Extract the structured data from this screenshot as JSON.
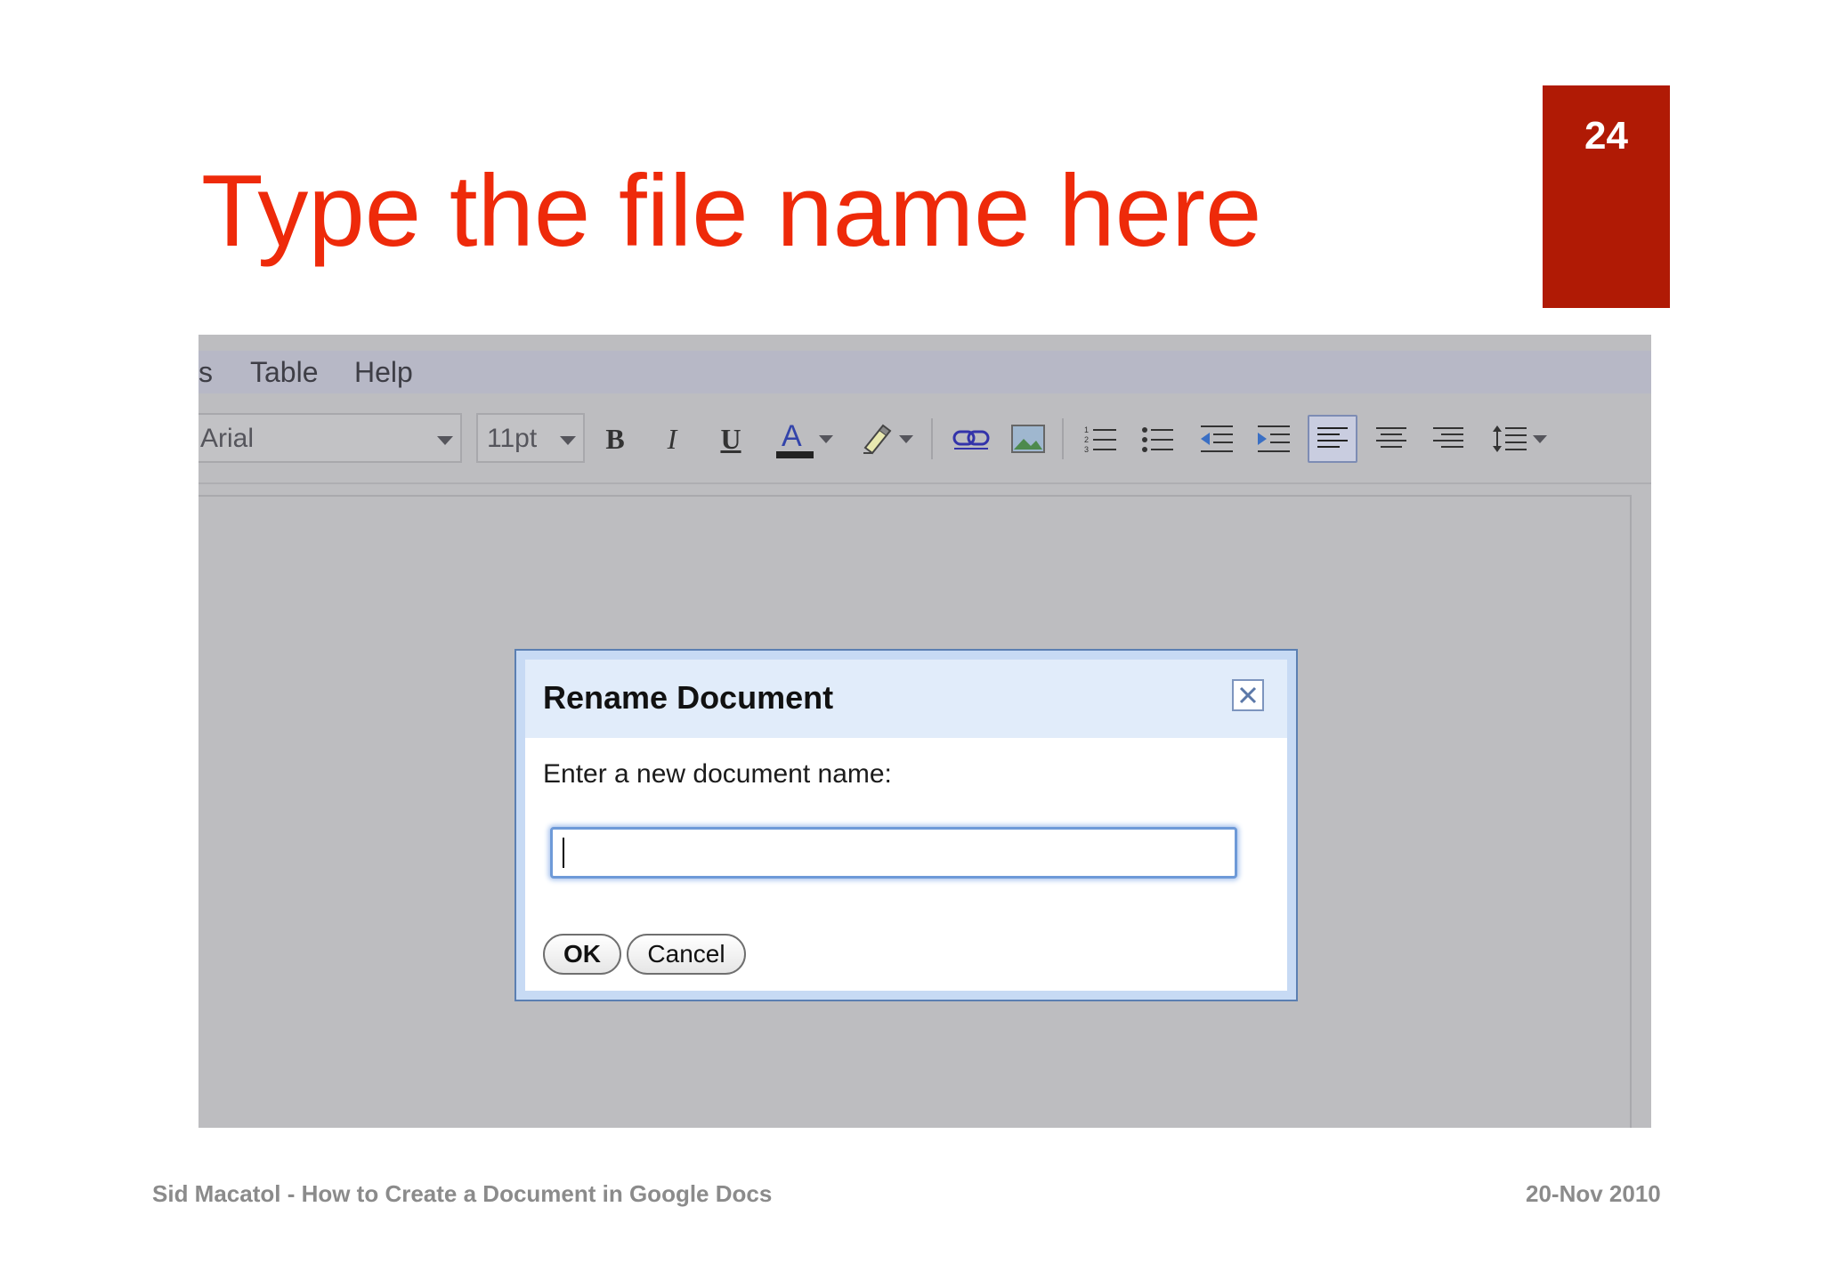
{
  "slide": {
    "number": "24",
    "title": "Type the file name here",
    "footer_left": "Sid Macatol - How to Create a Document in Google Docs",
    "footer_right": "20-Nov 2010",
    "accent_color": "#b01a05",
    "title_color": "#ee2a0a"
  },
  "app": {
    "menu": [
      {
        "label": "s"
      },
      {
        "label": "Table"
      },
      {
        "label": "Help"
      }
    ],
    "toolbar": {
      "font_family": "Arial",
      "font_size": "11pt",
      "buttons": [
        {
          "icon": "bold-icon"
        },
        {
          "icon": "italic-icon"
        },
        {
          "icon": "underline-icon"
        },
        {
          "icon": "text-color-icon"
        },
        {
          "icon": "highlight-color-icon"
        },
        {
          "icon": "link-icon"
        },
        {
          "icon": "insert-image-icon"
        },
        {
          "icon": "numbered-list-icon"
        },
        {
          "icon": "bulleted-list-icon"
        },
        {
          "icon": "decrease-indent-icon"
        },
        {
          "icon": "increase-indent-icon"
        },
        {
          "icon": "align-left-icon",
          "active": true
        },
        {
          "icon": "align-center-icon"
        },
        {
          "icon": "align-right-icon"
        },
        {
          "icon": "line-spacing-icon"
        }
      ],
      "bold_label": "B",
      "italic_label": "I",
      "underline_label": "U",
      "text_color_label": "A"
    }
  },
  "dialog": {
    "title": "Rename Document",
    "prompt": "Enter a new document name:",
    "input_value": "",
    "ok_label": "OK",
    "cancel_label": "Cancel"
  }
}
